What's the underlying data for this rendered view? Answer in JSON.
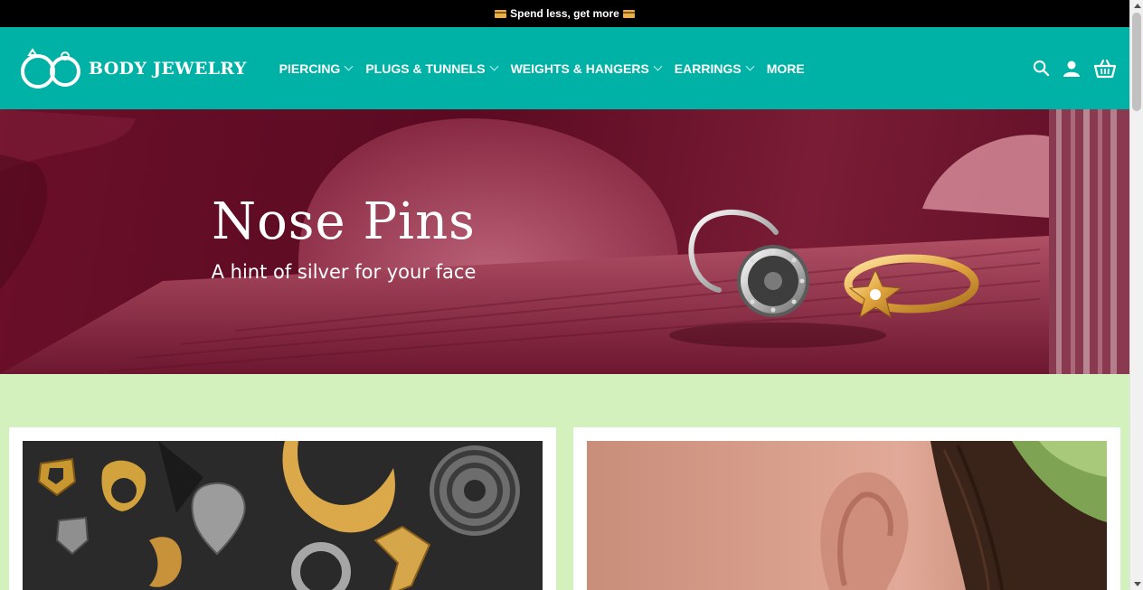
{
  "announcement": {
    "text": "Spend less, get more"
  },
  "brand": {
    "name": "BODY JEWELRY",
    "color": "#00b1a5"
  },
  "nav": {
    "items": [
      {
        "label": "PIERCING",
        "has_dropdown": true
      },
      {
        "label": "PLUGS & TUNNELS",
        "has_dropdown": true
      },
      {
        "label": "WEIGHTS & HANGERS",
        "has_dropdown": true
      },
      {
        "label": "EARRINGS",
        "has_dropdown": true
      },
      {
        "label": "MORE",
        "has_dropdown": false
      }
    ]
  },
  "header_icons": [
    "search-icon",
    "account-icon",
    "cart-icon"
  ],
  "hero": {
    "title": "Nose Pins",
    "subtitle": "A hint of silver for your face",
    "background": "#6b0f2a"
  },
  "section": {
    "background": "#d3f1bd"
  }
}
